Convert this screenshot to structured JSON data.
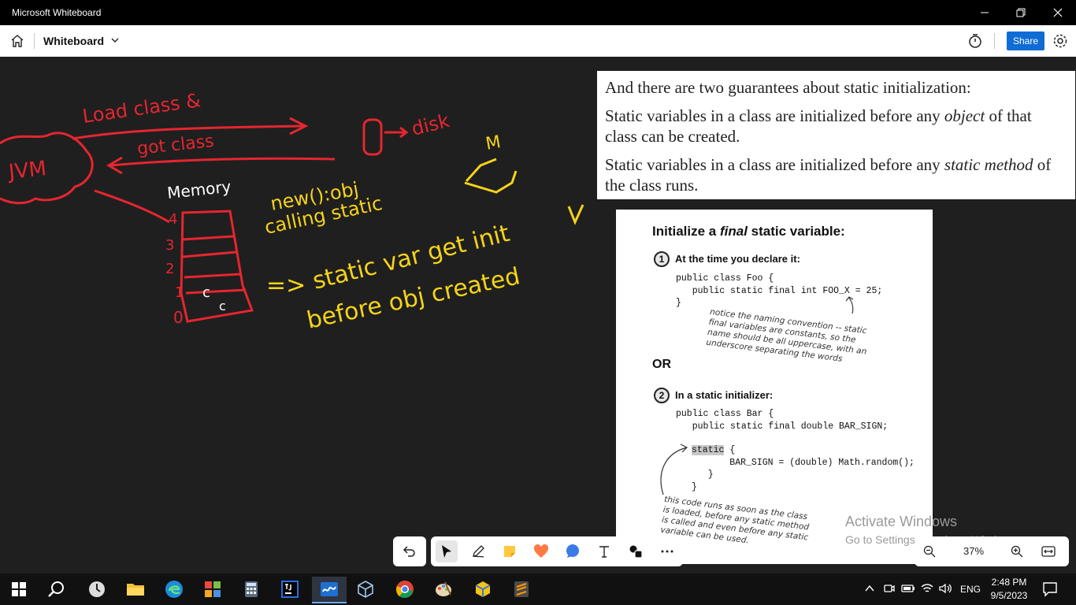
{
  "window": {
    "title": "Microsoft Whiteboard"
  },
  "toolbar": {
    "board_name": "Whiteboard",
    "share_label": "Share"
  },
  "ink": {
    "load_class": "Load class &",
    "got_class": "got class",
    "jvm": "JVM",
    "memory": "Memory",
    "disk": "disk",
    "new_obj": "new():obj",
    "calling_static": "calling static",
    "static_var": "static var get init",
    "before_obj": "before obj created",
    "arrow": "=>",
    "m": "M",
    "c1": "c",
    "c2": "c",
    "nums": [
      "4",
      "3",
      "2",
      "1",
      "0"
    ]
  },
  "quote": {
    "line1": "And there are two guarantees about static initialization:",
    "line2_pre": "Static variables in a class are initialized before any ",
    "line2_em": "object",
    "line2_post": " of that class can be created.",
    "line3_pre": "Static variables in a class are initialized before any ",
    "line3_em": "static method",
    "line3_post": " of the class runs."
  },
  "book": {
    "heading_pre": "Initialize a ",
    "heading_em": "final",
    "heading_post": " static variable:",
    "step1_num": "1",
    "step1": "At the time you declare it:",
    "code1": "public class Foo {\n   public static final int FOO_X = 25;\n}",
    "note1": "notice the naming convention -- static\nfinal variables are constants, so the\nname should be all uppercase, with an\nunderscore separating the words",
    "or": "OR",
    "step2_num": "2",
    "step2": "In a static initializer:",
    "code2": "public class Bar {\n   public static final double BAR_SIGN;",
    "code3_kw": "static",
    "code3_rest": " {\n       BAR_SIGN = (double) Math.random();\n   }\n}",
    "note2": "this code runs as soon as the class\nis loaded, before any static method\nis called and even before any static\nvariable can be used."
  },
  "watermark": {
    "line1": "Activate Windows",
    "line2": "Go to Settings to activate Windows."
  },
  "zoom": {
    "value": "37%"
  },
  "tray": {
    "lang": "ENG",
    "time": "2:48 PM",
    "date": "9/5/2023"
  },
  "icons": {
    "home": "home-icon",
    "chevron": "chevron-down-icon",
    "timer": "timer-icon",
    "settings": "gear-icon",
    "undo": "undo-icon",
    "select": "pointer-icon",
    "pen": "pen-icon",
    "note": "sticky-note-icon",
    "reaction": "heart-icon",
    "comment": "comment-icon",
    "text": "text-icon",
    "shapes": "shapes-icon",
    "more": "more-icon",
    "zoom_out": "zoom-out-icon",
    "zoom_in": "zoom-in-icon",
    "fit": "fit-screen-icon"
  },
  "colors": {
    "ink_red": "#e5262f",
    "ink_yellow": "#f5d31a",
    "share_blue": "#0f6cd4",
    "reaction_orange": "#ff7a45"
  }
}
